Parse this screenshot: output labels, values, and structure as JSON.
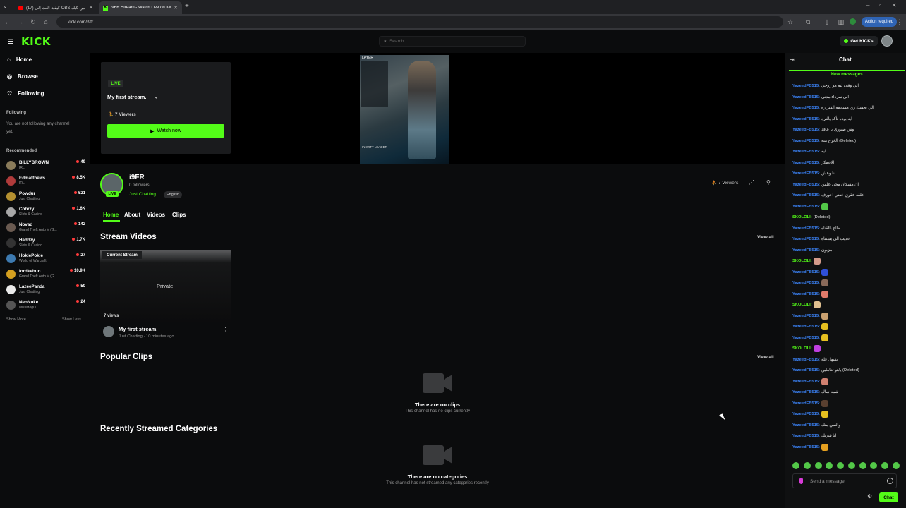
{
  "browser": {
    "tabs": [
      {
        "label": "(17) كيفية البث إلى OBS من كيك"
      },
      {
        "label": "i9FR Stream - Watch Live on KICK"
      }
    ],
    "url": "kick.com/i9fr",
    "action_label": "Action required"
  },
  "topnav": {
    "logo": "KICK",
    "search_placeholder": "Search",
    "get_kicks_label": "Get KICKs"
  },
  "sidebar": {
    "nav": [
      {
        "label": "Home"
      },
      {
        "label": "Browse"
      },
      {
        "label": "Following"
      }
    ],
    "following_heading": "Following",
    "following_empty": "You are not following any channel yet.",
    "recommended_heading": "Recommended",
    "recommended": [
      {
        "name": "BILLYBROWN",
        "category": "IRL",
        "viewers": "49",
        "color": "#8a7b5a"
      },
      {
        "name": "Edmatthews",
        "category": "IRL",
        "viewers": "8.5K",
        "color": "#b03b3b"
      },
      {
        "name": "Powdur",
        "category": "Just Chatting",
        "viewers": "521",
        "color": "#b49030"
      },
      {
        "name": "Cobrzy",
        "category": "Slots & Casino",
        "viewers": "1.6K",
        "color": "#a8a8a8"
      },
      {
        "name": "Novad",
        "category": "Grand Theft Auto V (G...",
        "viewers": "142",
        "color": "#6a5a50"
      },
      {
        "name": "Haddzy",
        "category": "Slots & Casino",
        "viewers": "1.7K",
        "color": "#333"
      },
      {
        "name": "HokiePokie",
        "category": "World of Warcraft",
        "viewers": "27",
        "color": "#3d7ab0"
      },
      {
        "name": "lordkebun",
        "category": "Grand Theft Auto V (G...",
        "viewers": "10.9K",
        "color": "#d4a020"
      },
      {
        "name": "LazeePanda",
        "category": "Just Chatting",
        "viewers": "50",
        "color": "#eaeaea"
      },
      {
        "name": "NeoNuke",
        "category": "MissMogul",
        "viewers": "24",
        "color": "#555"
      }
    ],
    "show_more": "Show More",
    "show_less": "Show Less"
  },
  "player": {
    "live_tag": "LIVE",
    "title": "My first stream.",
    "viewers": "7 Viewers",
    "watch_label": "Watch now",
    "thumb_label": "LAYER",
    "thumb_label2": "IN WITT LEADER"
  },
  "channel": {
    "name": "i9FR",
    "followers": "0 followers",
    "category": "Just Chatting",
    "language": "English",
    "live_badge": "LIVE",
    "viewers": "7 Viewers",
    "tabs": [
      {
        "label": "Home"
      },
      {
        "label": "About"
      },
      {
        "label": "Videos"
      },
      {
        "label": "Clips"
      }
    ]
  },
  "stream_videos": {
    "heading": "Stream Videos",
    "view_all": "View all",
    "card": {
      "tag": "Current Stream",
      "overlay": "Private",
      "views": "7 views",
      "title": "My first stream.",
      "meta": "Just Chatting · 10 minutes ago"
    }
  },
  "popular_clips": {
    "heading": "Popular Clips",
    "view_all": "View all",
    "empty_title": "There are no clips",
    "empty_sub": "This channel has no clips currently"
  },
  "recent_categories": {
    "heading": "Recently Streamed Categories",
    "empty_title": "There are no categories",
    "empty_sub": "This channel has not streamed any categories recently"
  },
  "chat": {
    "title": "Chat",
    "new_messages": "New messages",
    "messages": [
      {
        "user": "YazeedFB515:",
        "text": "الي وقف ليه مو زوجي",
        "color": "#3b82f6"
      },
      {
        "user": "YazeedFB515:",
        "text": "الى سرداء مدني",
        "color": "#3b82f6"
      },
      {
        "user": "YazeedFB515:",
        "text": "الي يحسك زي مسحمة الفتراره",
        "color": "#3b82f6"
      },
      {
        "user": "YazeedFB515:",
        "text": "ايه بوده تأكد يالتره",
        "color": "#3b82f6"
      },
      {
        "user": "YazeedFB515:",
        "text": "وش صبوري يا عاقد",
        "color": "#3b82f6"
      },
      {
        "user": "YazeedFB515:",
        "text": "الخرح منة (Deleted)",
        "color": "#3b82f6"
      },
      {
        "user": "YazeedFB515:",
        "text": "ليه",
        "color": "#3b82f6"
      },
      {
        "user": "YazeedFB515:",
        "text": "الاعمكر",
        "color": "#3b82f6"
      },
      {
        "user": "YazeedFB515:",
        "text": "انا وعش",
        "color": "#3b82f6"
      },
      {
        "user": "YazeedFB515:",
        "text": "ان مسكان محى علمن",
        "color": "#3b82f6"
      },
      {
        "user": "YazeedFB515:",
        "text": "علقه عقري عفني احورف",
        "color": "#3b82f6"
      },
      {
        "user": "YazeedFB515:",
        "text": "",
        "color": "#3b82f6",
        "emote": "#53c848"
      },
      {
        "user": "SKOLOLI:",
        "text": "(Deleted)",
        "color": "#53fc18"
      },
      {
        "user": "YazeedFB515:",
        "text": "طاح بالقناه",
        "color": "#3b82f6"
      },
      {
        "user": "YazeedFB515:",
        "text": "عديت الي يستناه",
        "color": "#3b82f6"
      },
      {
        "user": "YazeedFB515:",
        "text": "مزبون",
        "color": "#3b82f6"
      },
      {
        "user": "SKOLOLI:",
        "text": "",
        "color": "#53fc18",
        "emote": "#d49a8a"
      },
      {
        "user": "YazeedFB515:",
        "text": "",
        "color": "#3b82f6",
        "emote": "#2f4fd8"
      },
      {
        "user": "YazeedFB515:",
        "text": "",
        "color": "#3b82f6",
        "emote": "#8a6a5a"
      },
      {
        "user": "YazeedFB515:",
        "text": "",
        "color": "#3b82f6",
        "emote": "#e07a6a"
      },
      {
        "user": "SKOLOLI:",
        "text": "",
        "color": "#53fc18",
        "emote": "#e0c090"
      },
      {
        "user": "YazeedFB515:",
        "text": "",
        "color": "#3b82f6",
        "emote": "#c8a070"
      },
      {
        "user": "YazeedFB515:",
        "text": "",
        "color": "#3b82f6",
        "emote": "#e6c020"
      },
      {
        "user": "YazeedFB515:",
        "text": "",
        "color": "#3b82f6",
        "emote": "#e6c020"
      },
      {
        "user": "SKOLOLI:",
        "text": "",
        "color": "#53fc18",
        "emote": "#c040e0"
      },
      {
        "user": "YazeedFB515:",
        "text": "يسهل فله",
        "color": "#3b82f6"
      },
      {
        "user": "YazeedFB515:",
        "text": "ياهو تعاملين (Deleted)",
        "color": "#3b82f6"
      },
      {
        "user": "YazeedFB515:",
        "text": "",
        "color": "#3b82f6",
        "emote": "#d08070"
      },
      {
        "user": "YazeedFB515:",
        "text": "شمه ساك",
        "color": "#3b82f6"
      },
      {
        "user": "YazeedFB515:",
        "text": "",
        "color": "#3b82f6",
        "emote": "#5a4030"
      },
      {
        "user": "YazeedFB515:",
        "text": "",
        "color": "#3b82f6",
        "emote": "#e6c020"
      },
      {
        "user": "YazeedFB515:",
        "text": "والسن منك",
        "color": "#3b82f6"
      },
      {
        "user": "YazeedFB515:",
        "text": "انا شريك",
        "color": "#3b82f6"
      },
      {
        "user": "YazeedFB515:",
        "text": "",
        "color": "#3b82f6",
        "emote": "#e6a020"
      }
    ],
    "input_placeholder": "Send a message",
    "send_label": "Chat"
  }
}
